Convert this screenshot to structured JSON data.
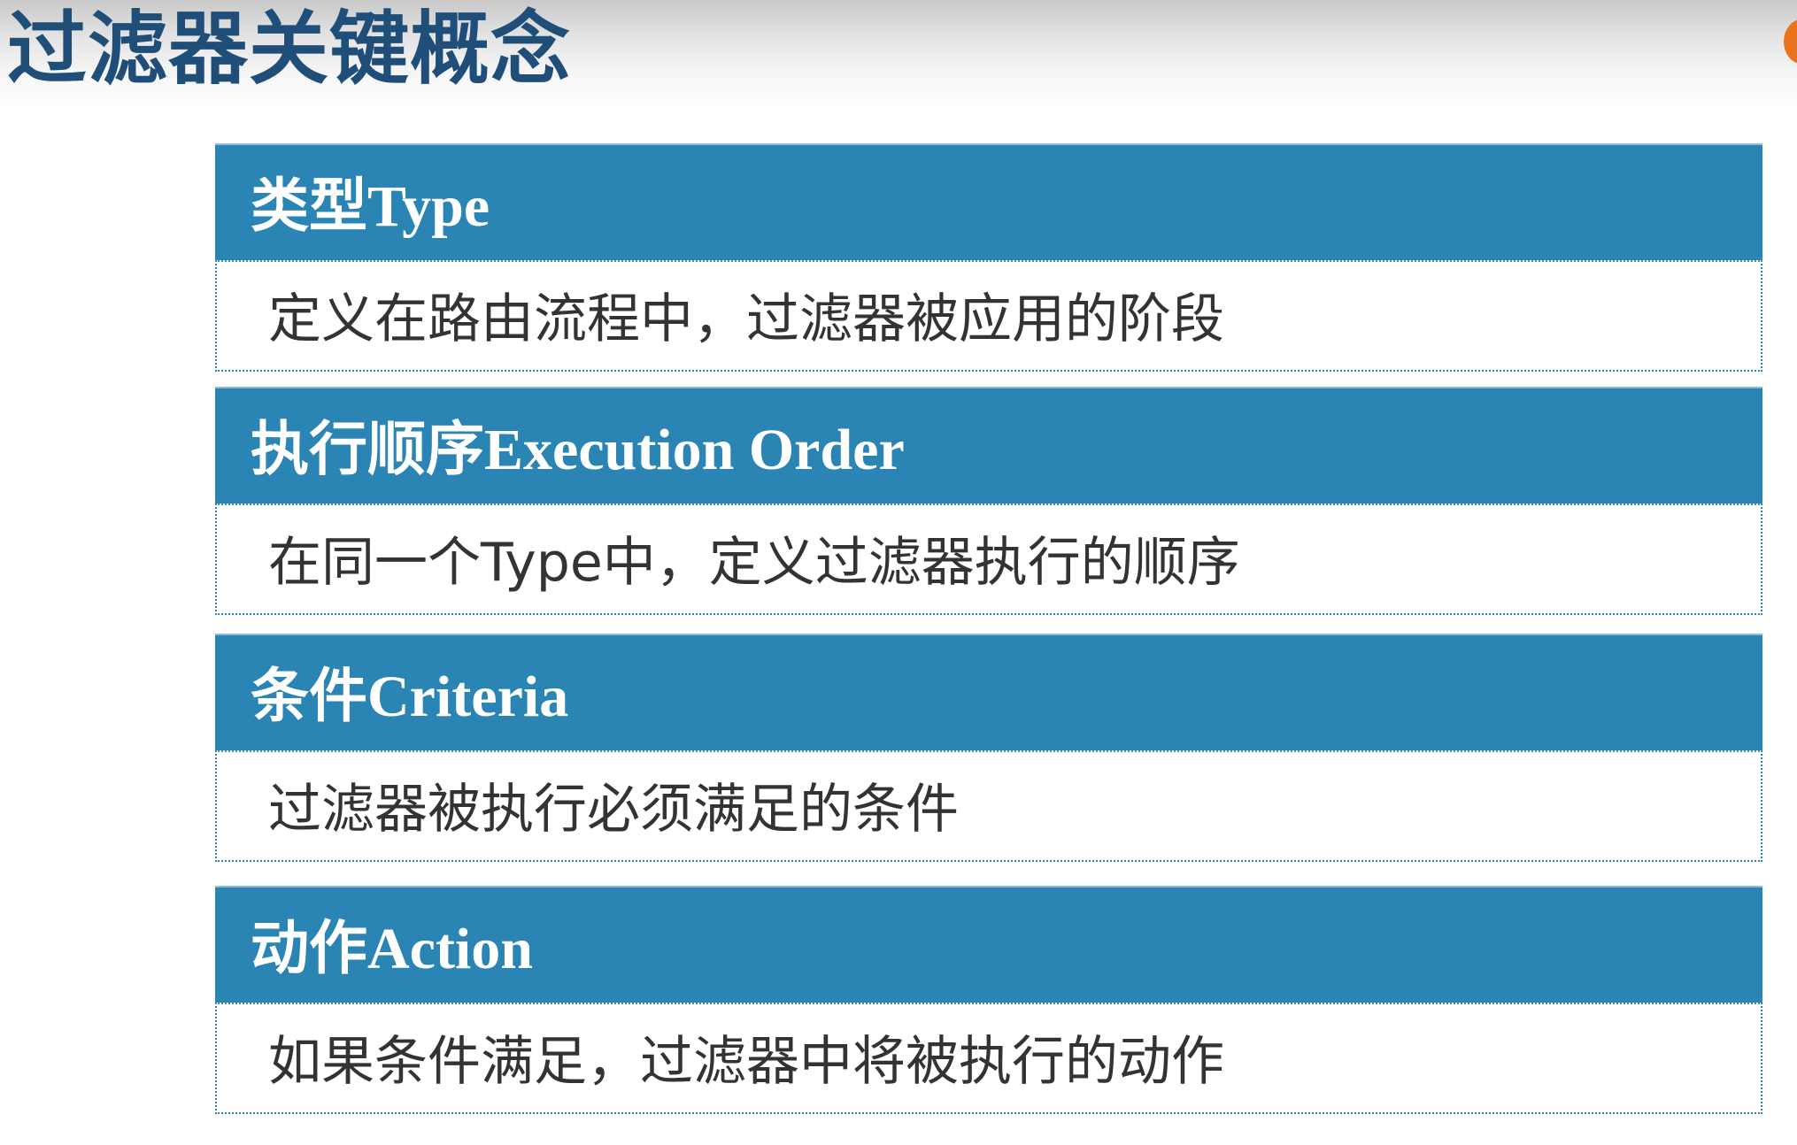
{
  "slide": {
    "title": "过滤器关键概念"
  },
  "concepts": [
    {
      "heading": "类型Type",
      "description": "定义在路由流程中，过滤器被应用的阶段"
    },
    {
      "heading": "执行顺序Execution Order",
      "description": "在同一个Type中，定义过滤器执行的顺序"
    },
    {
      "heading": "条件Criteria",
      "description": "过滤器被执行必须满足的条件"
    },
    {
      "heading": "动作Action",
      "description": "如果条件满足，过滤器中将被执行的动作"
    }
  ],
  "colors": {
    "title_text": "#1f4e79",
    "header_background": "#2a84b4",
    "header_text": "#ffffff",
    "body_text": "#333333",
    "corner_mark": "#e8741f"
  }
}
